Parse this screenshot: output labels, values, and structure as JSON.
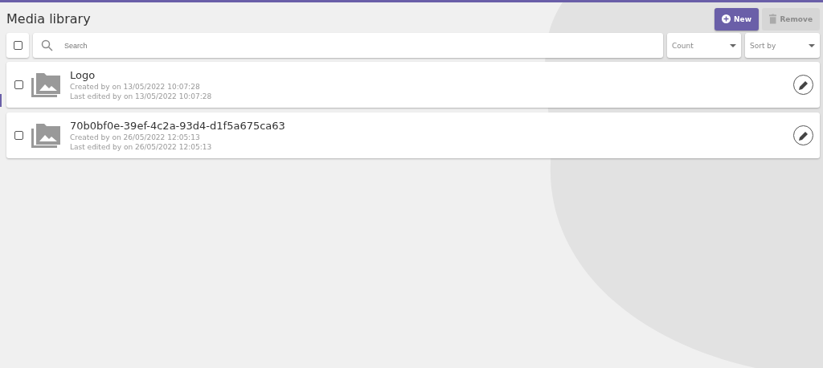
{
  "title": "Media library",
  "buttons": [
    {
      "kind": "add",
      "label": "New",
      "disabled": false
    },
    {
      "kind": "delete",
      "label": "Remove",
      "disabled": true
    }
  ],
  "toolbar": {
    "select_all": {
      "checked": false
    },
    "search": {
      "placeholder": "Search"
    },
    "dropdowns": [
      {
        "placeholder": "Count"
      },
      {
        "placeholder": "Sort by"
      }
    ]
  },
  "items": [
    {
      "name": "Logo",
      "created": "Created by on 13/05/2022 10:07:28",
      "edited": "Last edited by on 13/05/2022 10:07:28",
      "checked": false
    },
    {
      "name": "70b0bf0e-39ef-4c2a-93d4-d1f5a675ca63",
      "created": "Created by on 26/05/2022 12:05:13",
      "edited": "Last edited by on 26/05/2022 12:05:13",
      "checked": false
    }
  ]
}
